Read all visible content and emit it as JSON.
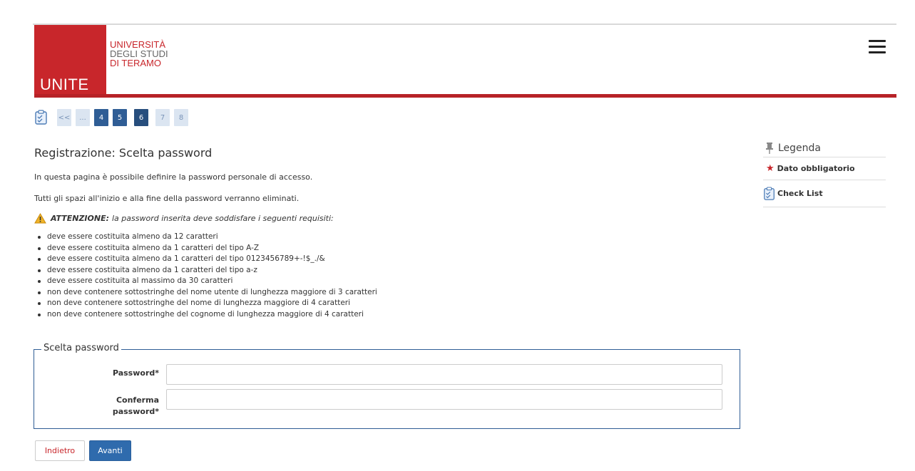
{
  "header": {
    "logo_abbr": "UNITE",
    "logo_line1": "UNIVERSITÀ",
    "logo_line2": "DEGLI STUDI",
    "logo_line3": "DI TERAMO",
    "menu_icon": "hamburger-menu-icon"
  },
  "steps": {
    "icon": "checklist-icon",
    "items": [
      "<<",
      "...",
      "4",
      "5",
      "6",
      "7",
      "8"
    ],
    "current": "6"
  },
  "main": {
    "title": "Registrazione: Scelta password",
    "intro1": "In questa pagina è possibile definire la password personale di accesso.",
    "intro2": "Tutti gli spazi all'inizio e alla fine della password verranno eliminati.",
    "warning_label": "ATTENZIONE:",
    "warning_text": "la password inserita deve soddisfare i seguenti requisiti:",
    "requirements": [
      "deve essere costituita almeno da 12 caratteri",
      "deve essere costituita almeno da 1 caratteri del tipo A-Z",
      "deve essere costituita almeno da 1 caratteri del tipo 0123456789+-!$_./&",
      "deve essere costituita almeno da 1 caratteri del tipo a-z",
      "deve essere costituita al massimo da 30 caratteri",
      "non deve contenere sottostringhe del nome utente di lunghezza maggiore di 3 caratteri",
      "non deve contenere sottostringhe del nome di lunghezza maggiore di 4 caratteri",
      "non deve contenere sottostringhe del cognome di lunghezza maggiore di 4 caratteri"
    ]
  },
  "form": {
    "legend": "Scelta password",
    "password_label": "Password*",
    "password_value": "",
    "confirm_label_1": "Conferma",
    "confirm_label_2": "password*",
    "confirm_value": ""
  },
  "buttons": {
    "back": "Indietro",
    "next": "Avanti"
  },
  "legend_panel": {
    "title": "Legenda",
    "required": "Dato obbligatorio",
    "checklist": "Check List"
  },
  "colors": {
    "brand_red": "#c8262b",
    "brand_blue": "#2f5d95"
  }
}
